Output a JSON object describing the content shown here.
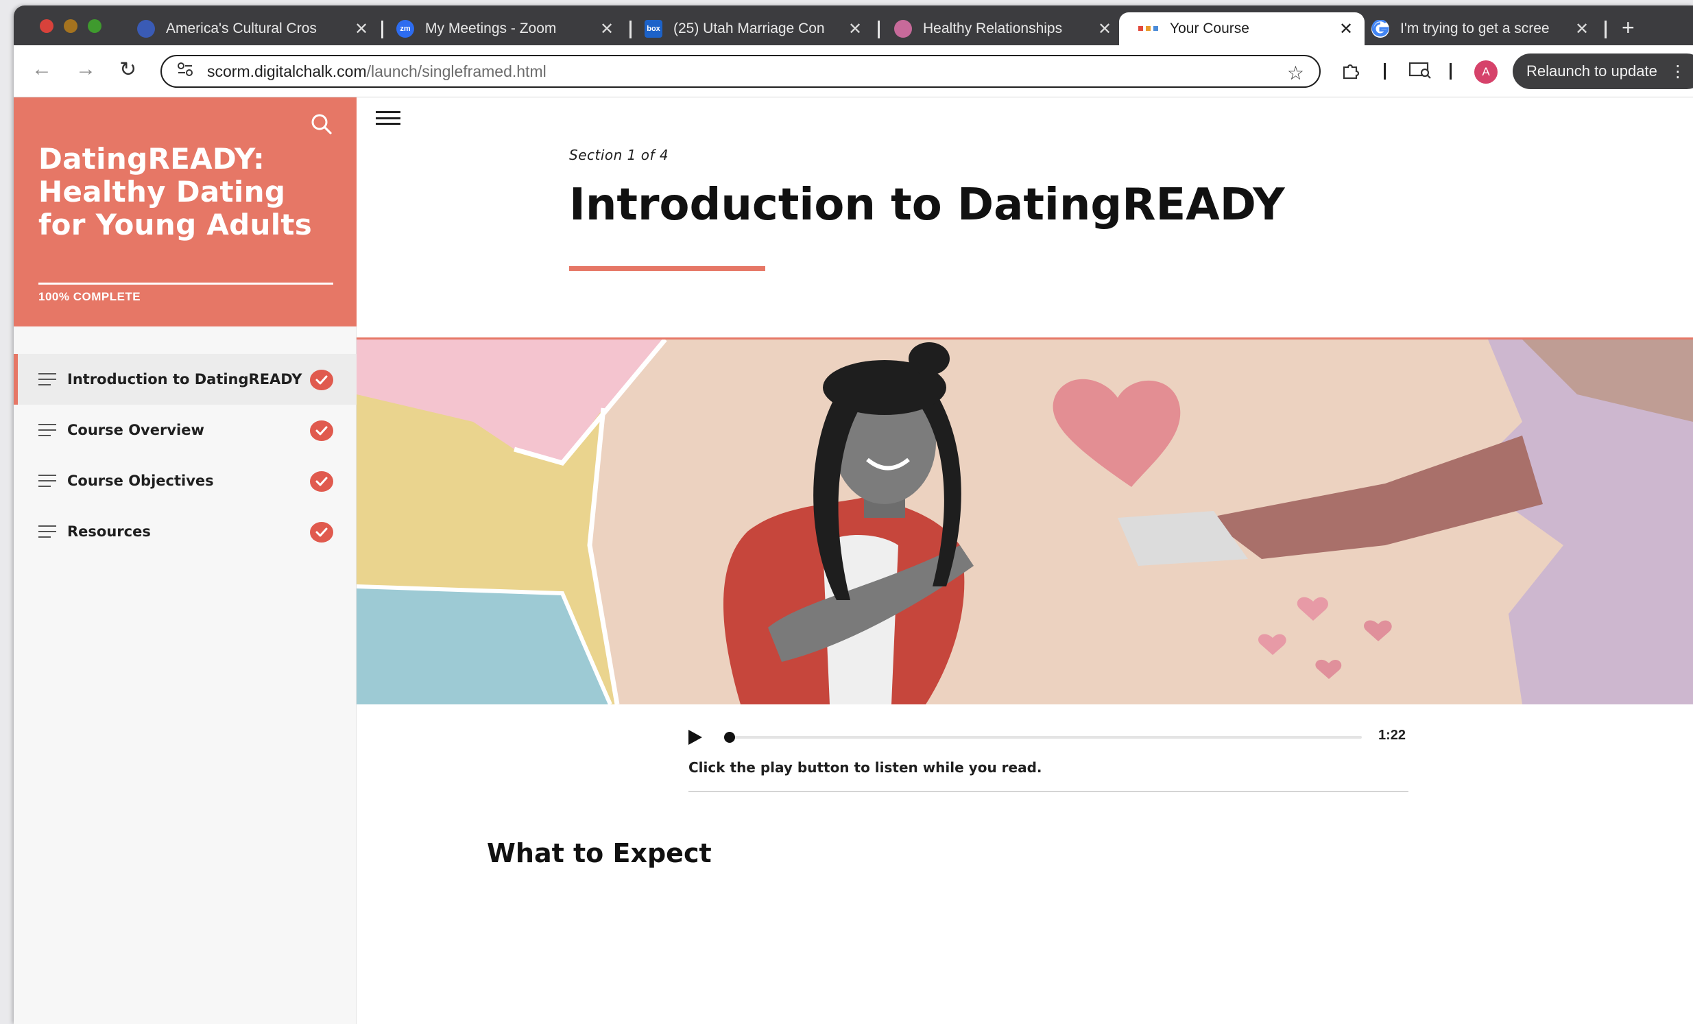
{
  "browser": {
    "tabs": [
      {
        "title": "America's Cultural Cros",
        "favicon_color": "#3a5bb5",
        "close": "✕"
      },
      {
        "title": "My Meetings - Zoom",
        "favicon_color": "#2d6cf0",
        "favicon_text": "zm",
        "close": "✕"
      },
      {
        "title": "(25) Utah Marriage Con",
        "favicon_color": "#1c62c9",
        "favicon_text": "box",
        "close": "✕"
      },
      {
        "title": "Healthy Relationships",
        "favicon_color": "#c76a9a",
        "close": "✕"
      },
      {
        "title": "Your Course",
        "favicon_color": "#e2493c",
        "close": "✕",
        "active": true
      },
      {
        "title": "I'm trying to get a scree",
        "favicon_color": "#4285f4",
        "close": "✕"
      }
    ],
    "new_tab": "+",
    "url_host": "scorm.digitalchalk.com",
    "url_path": "/launch/singleframed.html",
    "avatar_letter": "A",
    "relaunch_label": "Relaunch to update"
  },
  "course": {
    "title": "DatingREADY: Healthy Dating for Young Adults",
    "progress_text": "100% COMPLETE",
    "progress_percent": 100,
    "accent_color": "#e67766",
    "lessons": [
      {
        "label": "Introduction to DatingREADY",
        "complete": true,
        "active": true
      },
      {
        "label": "Course Overview",
        "complete": true
      },
      {
        "label": "Course Objectives",
        "complete": true
      },
      {
        "label": "Resources",
        "complete": true
      }
    ]
  },
  "lesson": {
    "section_label": "Section 1 of 4",
    "title": "Introduction to DatingREADY",
    "audio": {
      "duration": "1:22",
      "progress_fraction": 0,
      "caption": "Click the play button to listen while you read."
    },
    "subheading": "What to Expect"
  }
}
